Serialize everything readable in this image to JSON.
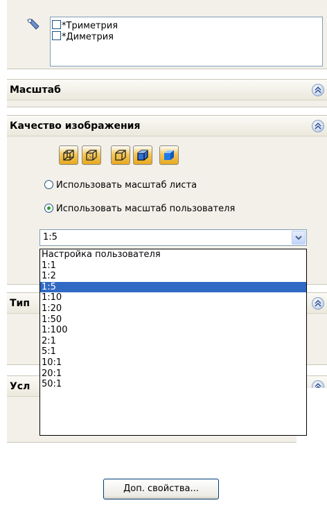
{
  "view_list": {
    "items": [
      {
        "label": "*Триметрия",
        "checked": false
      },
      {
        "label": "*Диметрия",
        "checked": false
      }
    ]
  },
  "sections": {
    "scale": {
      "title": "Масштаб"
    },
    "quality": {
      "title": "Качество изображения"
    },
    "type": {
      "title": "Тип"
    },
    "condition": {
      "title": "Усл"
    }
  },
  "display_modes": [
    "wireframe-icon",
    "hidden-lines-visible-icon",
    "hidden-lines-removed-icon",
    "shaded-with-edges-icon",
    "shaded-icon"
  ],
  "scale_options": {
    "use_sheet_scale": {
      "label": "Использовать масштаб листа",
      "selected": false
    },
    "use_custom_scale": {
      "label": "Использовать масштаб пользователя",
      "selected": true
    }
  },
  "scale_combo": {
    "value": "1:5",
    "options": [
      "Настройка пользователя",
      "1:1",
      "1:2",
      "1:5",
      "1:10",
      "1:20",
      "1:50",
      "1:100",
      "2:1",
      "5:1",
      "10:1",
      "20:1",
      "50:1"
    ],
    "highlighted": "1:5"
  },
  "more_button": {
    "label": "Доп. свойства..."
  },
  "colors": {
    "panel": "#f2f0e8",
    "selection": "#316ac5",
    "accent_orange": "#e8a820"
  }
}
